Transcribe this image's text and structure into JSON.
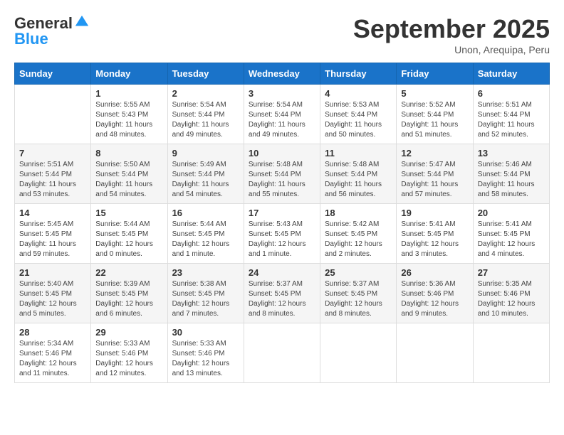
{
  "logo": {
    "general": "General",
    "blue": "Blue"
  },
  "header": {
    "month": "September 2025",
    "location": "Unon, Arequipa, Peru"
  },
  "weekdays": [
    "Sunday",
    "Monday",
    "Tuesday",
    "Wednesday",
    "Thursday",
    "Friday",
    "Saturday"
  ],
  "weeks": [
    [
      {
        "day": "",
        "sunrise": "",
        "sunset": "",
        "daylight": ""
      },
      {
        "day": "1",
        "sunrise": "Sunrise: 5:55 AM",
        "sunset": "Sunset: 5:43 PM",
        "daylight": "Daylight: 11 hours and 48 minutes."
      },
      {
        "day": "2",
        "sunrise": "Sunrise: 5:54 AM",
        "sunset": "Sunset: 5:44 PM",
        "daylight": "Daylight: 11 hours and 49 minutes."
      },
      {
        "day": "3",
        "sunrise": "Sunrise: 5:54 AM",
        "sunset": "Sunset: 5:44 PM",
        "daylight": "Daylight: 11 hours and 49 minutes."
      },
      {
        "day": "4",
        "sunrise": "Sunrise: 5:53 AM",
        "sunset": "Sunset: 5:44 PM",
        "daylight": "Daylight: 11 hours and 50 minutes."
      },
      {
        "day": "5",
        "sunrise": "Sunrise: 5:52 AM",
        "sunset": "Sunset: 5:44 PM",
        "daylight": "Daylight: 11 hours and 51 minutes."
      },
      {
        "day": "6",
        "sunrise": "Sunrise: 5:51 AM",
        "sunset": "Sunset: 5:44 PM",
        "daylight": "Daylight: 11 hours and 52 minutes."
      }
    ],
    [
      {
        "day": "7",
        "sunrise": "Sunrise: 5:51 AM",
        "sunset": "Sunset: 5:44 PM",
        "daylight": "Daylight: 11 hours and 53 minutes."
      },
      {
        "day": "8",
        "sunrise": "Sunrise: 5:50 AM",
        "sunset": "Sunset: 5:44 PM",
        "daylight": "Daylight: 11 hours and 54 minutes."
      },
      {
        "day": "9",
        "sunrise": "Sunrise: 5:49 AM",
        "sunset": "Sunset: 5:44 PM",
        "daylight": "Daylight: 11 hours and 54 minutes."
      },
      {
        "day": "10",
        "sunrise": "Sunrise: 5:48 AM",
        "sunset": "Sunset: 5:44 PM",
        "daylight": "Daylight: 11 hours and 55 minutes."
      },
      {
        "day": "11",
        "sunrise": "Sunrise: 5:48 AM",
        "sunset": "Sunset: 5:44 PM",
        "daylight": "Daylight: 11 hours and 56 minutes."
      },
      {
        "day": "12",
        "sunrise": "Sunrise: 5:47 AM",
        "sunset": "Sunset: 5:44 PM",
        "daylight": "Daylight: 11 hours and 57 minutes."
      },
      {
        "day": "13",
        "sunrise": "Sunrise: 5:46 AM",
        "sunset": "Sunset: 5:44 PM",
        "daylight": "Daylight: 11 hours and 58 minutes."
      }
    ],
    [
      {
        "day": "14",
        "sunrise": "Sunrise: 5:45 AM",
        "sunset": "Sunset: 5:45 PM",
        "daylight": "Daylight: 11 hours and 59 minutes."
      },
      {
        "day": "15",
        "sunrise": "Sunrise: 5:44 AM",
        "sunset": "Sunset: 5:45 PM",
        "daylight": "Daylight: 12 hours and 0 minutes."
      },
      {
        "day": "16",
        "sunrise": "Sunrise: 5:44 AM",
        "sunset": "Sunset: 5:45 PM",
        "daylight": "Daylight: 12 hours and 1 minute."
      },
      {
        "day": "17",
        "sunrise": "Sunrise: 5:43 AM",
        "sunset": "Sunset: 5:45 PM",
        "daylight": "Daylight: 12 hours and 1 minute."
      },
      {
        "day": "18",
        "sunrise": "Sunrise: 5:42 AM",
        "sunset": "Sunset: 5:45 PM",
        "daylight": "Daylight: 12 hours and 2 minutes."
      },
      {
        "day": "19",
        "sunrise": "Sunrise: 5:41 AM",
        "sunset": "Sunset: 5:45 PM",
        "daylight": "Daylight: 12 hours and 3 minutes."
      },
      {
        "day": "20",
        "sunrise": "Sunrise: 5:41 AM",
        "sunset": "Sunset: 5:45 PM",
        "daylight": "Daylight: 12 hours and 4 minutes."
      }
    ],
    [
      {
        "day": "21",
        "sunrise": "Sunrise: 5:40 AM",
        "sunset": "Sunset: 5:45 PM",
        "daylight": "Daylight: 12 hours and 5 minutes."
      },
      {
        "day": "22",
        "sunrise": "Sunrise: 5:39 AM",
        "sunset": "Sunset: 5:45 PM",
        "daylight": "Daylight: 12 hours and 6 minutes."
      },
      {
        "day": "23",
        "sunrise": "Sunrise: 5:38 AM",
        "sunset": "Sunset: 5:45 PM",
        "daylight": "Daylight: 12 hours and 7 minutes."
      },
      {
        "day": "24",
        "sunrise": "Sunrise: 5:37 AM",
        "sunset": "Sunset: 5:45 PM",
        "daylight": "Daylight: 12 hours and 8 minutes."
      },
      {
        "day": "25",
        "sunrise": "Sunrise: 5:37 AM",
        "sunset": "Sunset: 5:45 PM",
        "daylight": "Daylight: 12 hours and 8 minutes."
      },
      {
        "day": "26",
        "sunrise": "Sunrise: 5:36 AM",
        "sunset": "Sunset: 5:46 PM",
        "daylight": "Daylight: 12 hours and 9 minutes."
      },
      {
        "day": "27",
        "sunrise": "Sunrise: 5:35 AM",
        "sunset": "Sunset: 5:46 PM",
        "daylight": "Daylight: 12 hours and 10 minutes."
      }
    ],
    [
      {
        "day": "28",
        "sunrise": "Sunrise: 5:34 AM",
        "sunset": "Sunset: 5:46 PM",
        "daylight": "Daylight: 12 hours and 11 minutes."
      },
      {
        "day": "29",
        "sunrise": "Sunrise: 5:33 AM",
        "sunset": "Sunset: 5:46 PM",
        "daylight": "Daylight: 12 hours and 12 minutes."
      },
      {
        "day": "30",
        "sunrise": "Sunrise: 5:33 AM",
        "sunset": "Sunset: 5:46 PM",
        "daylight": "Daylight: 12 hours and 13 minutes."
      },
      {
        "day": "",
        "sunrise": "",
        "sunset": "",
        "daylight": ""
      },
      {
        "day": "",
        "sunrise": "",
        "sunset": "",
        "daylight": ""
      },
      {
        "day": "",
        "sunrise": "",
        "sunset": "",
        "daylight": ""
      },
      {
        "day": "",
        "sunrise": "",
        "sunset": "",
        "daylight": ""
      }
    ]
  ]
}
